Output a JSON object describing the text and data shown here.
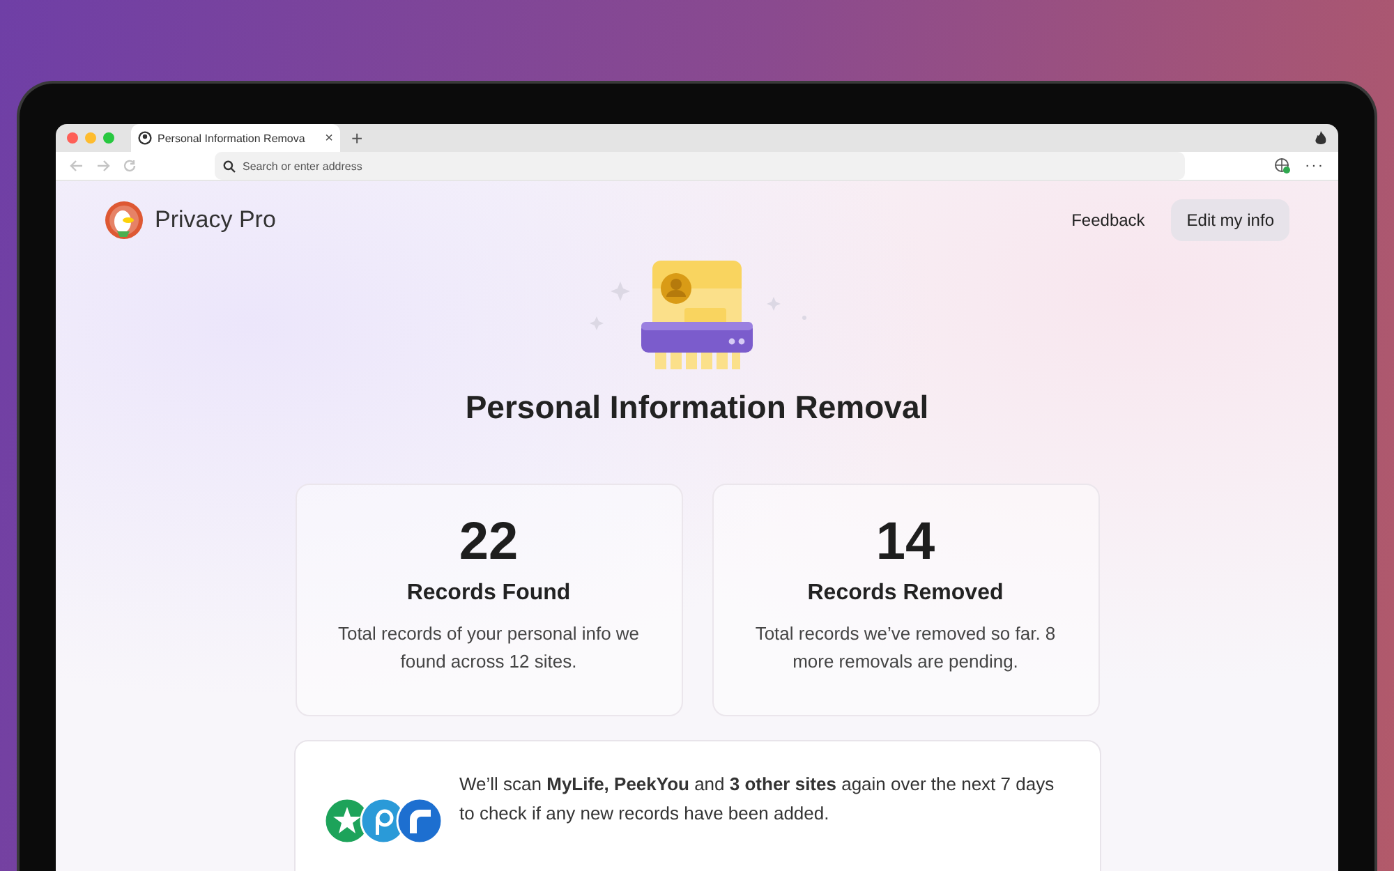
{
  "browser": {
    "tab": {
      "title": "Personal Information Remova",
      "close": "×"
    },
    "new_tab": "+",
    "address_bar": {
      "placeholder": "Search or enter address"
    },
    "menu": "···"
  },
  "header": {
    "brand": "Privacy Pro",
    "buttons": [
      {
        "label": "Feedback",
        "kind": "text"
      },
      {
        "label": "Edit my info",
        "kind": "filled"
      }
    ]
  },
  "title": "Personal Information Removal",
  "stats": [
    {
      "value": "22",
      "label": "Records Found",
      "description": "Total records of your personal info we found across 12 sites."
    },
    {
      "value": "14",
      "label": "Records Removed",
      "description": "Total records we’ve removed so far. 8 more removals are pending."
    }
  ],
  "scan_notice": {
    "text": "We’ll scan **MyLife, PeekYou** and **3 other sites** again over the next 7 days to check if any new records have been added.",
    "sites": [
      {
        "kind": "star",
        "color": "#1da35a"
      },
      {
        "kind": "ring",
        "color": "#2a9ad8"
      },
      {
        "kind": "arc",
        "color": "#1d6fd0"
      }
    ]
  }
}
